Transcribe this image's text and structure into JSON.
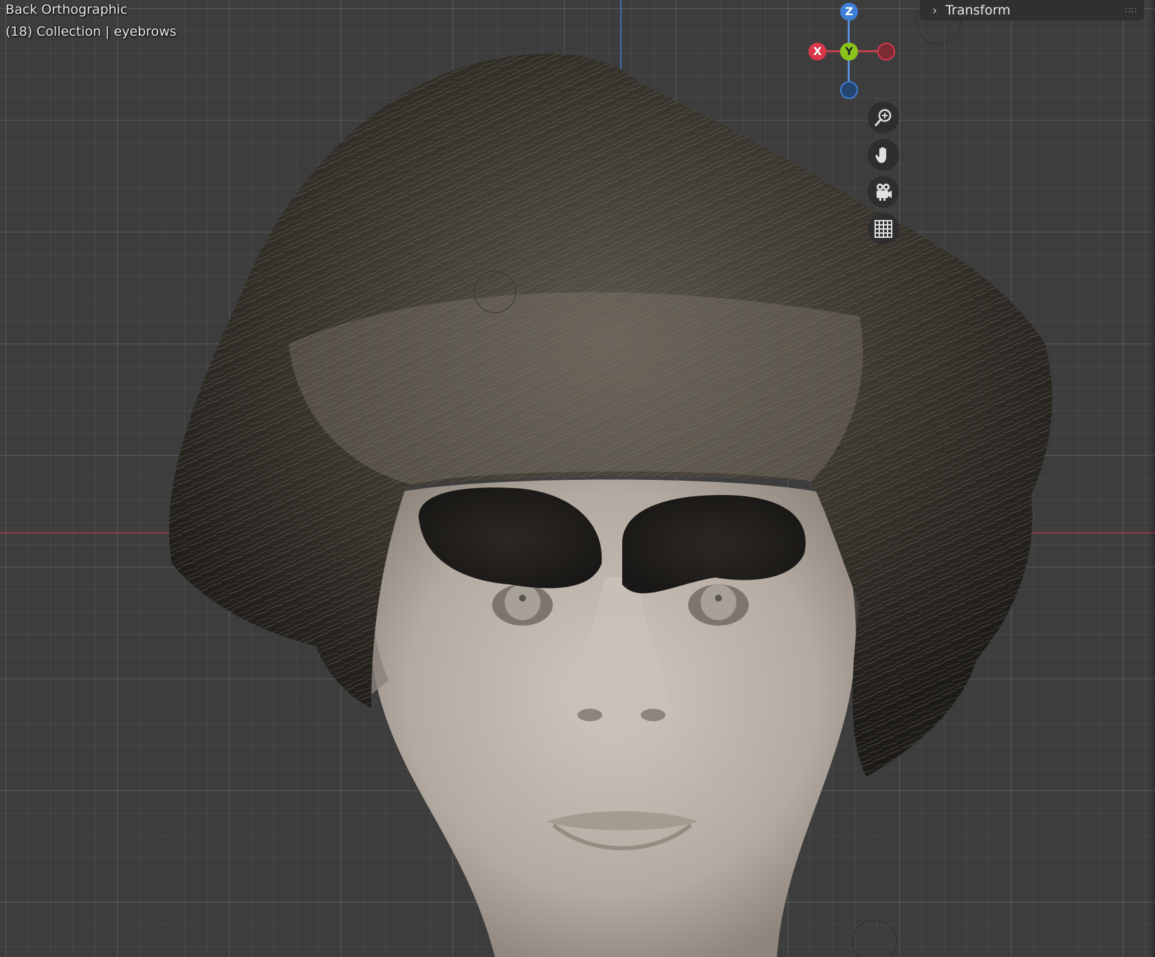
{
  "viewport": {
    "view_name": "Back Orthographic",
    "collection_info": "(18) Collection | eyebrows"
  },
  "gizmo": {
    "z_label": "Z",
    "y_label": "Y",
    "x_label": "X",
    "colors": {
      "x": "#d8374a",
      "y": "#8ac41b",
      "z": "#3d7ed6"
    }
  },
  "nav_tools": [
    {
      "name": "zoom",
      "icon": "zoom-icon"
    },
    {
      "name": "pan",
      "icon": "hand-icon"
    },
    {
      "name": "camera",
      "icon": "camera-icon"
    },
    {
      "name": "ortho-toggle",
      "icon": "grid-icon"
    }
  ],
  "sidebar": {
    "transform_label": "Transform"
  },
  "colors": {
    "background": "#3d3d3d",
    "x_axis": "#9b3b48",
    "z_axis": "#3f6ea8",
    "hair": "#2a2723",
    "skin": "#bfb6ad"
  }
}
